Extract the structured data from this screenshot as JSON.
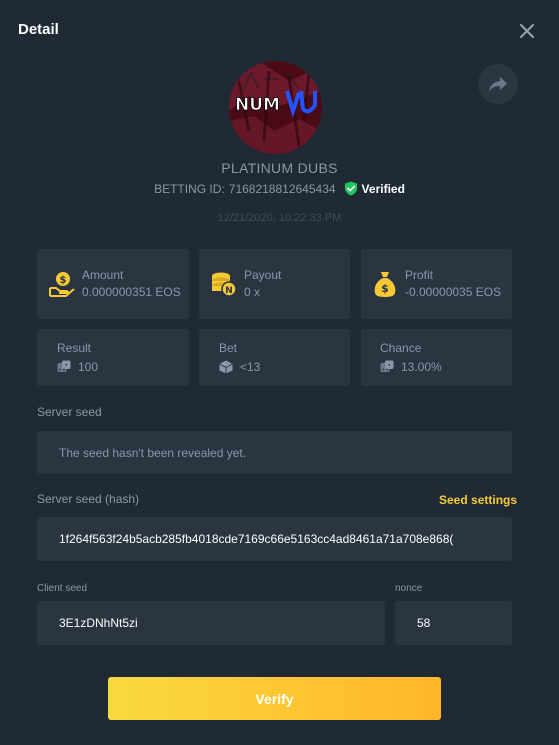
{
  "modal": {
    "title": "Detail"
  },
  "player": {
    "name": "PLATINUM DUBS",
    "avatar_text": "NUM DJ",
    "betting_id_label": "BETTING ID:",
    "betting_id": "7168218812645434",
    "verified_label": "Verified",
    "timestamp": "12/21/2020, 10:22:33 PM"
  },
  "stats": [
    {
      "label": "Amount",
      "value": "0.000000351 EOS",
      "icon": "coin-hand-icon"
    },
    {
      "label": "Payout",
      "value": "0 x",
      "icon": "coin-stack-icon"
    },
    {
      "label": "Profit",
      "value": "-0.00000035 EOS",
      "icon": "money-bag-icon"
    },
    {
      "label": "Result",
      "value": "100",
      "icon": "dice-icon"
    },
    {
      "label": "Bet",
      "value": "<13",
      "icon": "dice-icon"
    },
    {
      "label": "Chance",
      "value": "13.00%",
      "icon": "dice-icon"
    }
  ],
  "server_seed": {
    "label": "Server seed",
    "value": "The seed hasn't been revealed yet."
  },
  "server_seed_hash": {
    "label": "Server seed (hash)",
    "settings_link": "Seed settings",
    "value": "1f264f563f24b5acb285fb4018cde7169c66e5163cc4ad8461a71a708e868("
  },
  "client_seed": {
    "label": "Client seed",
    "value": "3E1zDNhNt5zi"
  },
  "nonce": {
    "label": "nonce",
    "value": "58"
  },
  "verify_button": {
    "label": "Verify"
  },
  "colors": {
    "background": "#1f2a35",
    "card": "#2a3541",
    "accent": "#f6c936",
    "verified_green": "#23c55e"
  }
}
